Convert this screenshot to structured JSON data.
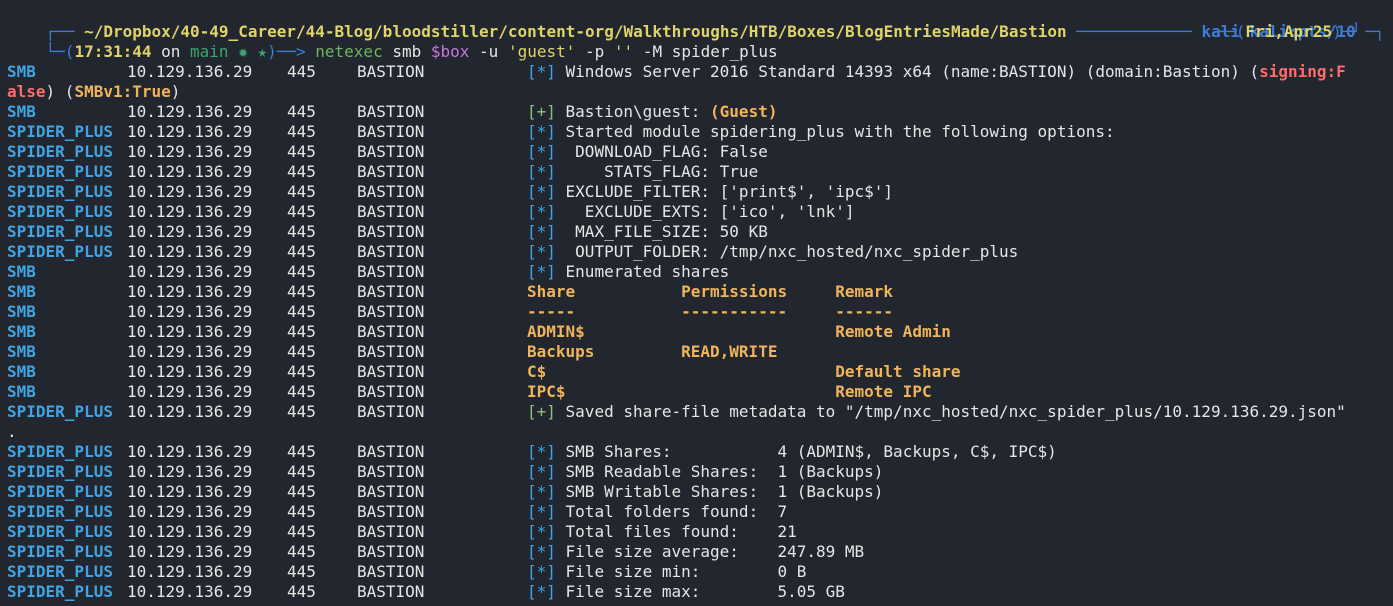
{
  "prompt": {
    "line1": {
      "corner": "┌── ",
      "path": "~/Dropbox/40-49_Career/44-Blog/bloodstiller/content-org/Walkthroughs/HTB/Boxes/BlogEntriesMade/Bastion",
      "sep": " ──────────── ",
      "user": "kali kali:pts/10",
      "end": " ─┐"
    },
    "line2": {
      "corner": "└─(",
      "time": "17:31:44",
      "on": " on ",
      "branch": "main ✹ ★",
      "arrow": ")──> ",
      "cmd": "netexec",
      "args1": " smb ",
      "var": "$box",
      "args2": " -u ",
      "user_str": "'guest'",
      "args3": " -p ",
      "pass_str": "''",
      "args4": " -M spider_plus",
      "date_prefix": "──(",
      "date": "Fri,Apr25",
      "date_suffix": ")─┘"
    }
  },
  "rows": [
    {
      "proto": "SMB",
      "ip": "10.129.136.29",
      "port": "445",
      "host": "BASTION",
      "badge": "[*]",
      "msg": " Windows Server 2016 Standard 14393 x64 (name:BASTION) (domain:Bastion) (",
      "hl": "signing:F",
      "type": "signing"
    },
    {
      "cont": "alse",
      "cont2": ") (",
      "hl": "SMBv1:True",
      "cont3": ")",
      "type": "wrap"
    },
    {
      "proto": "SMB",
      "ip": "10.129.136.29",
      "port": "445",
      "host": "BASTION",
      "badge": "[+]",
      "msg": " Bastion\\guest: ",
      "hl": "(Guest)",
      "type": "guest"
    },
    {
      "proto": "SPIDER_PLUS",
      "ip": "10.129.136.29",
      "port": "445",
      "host": "BASTION",
      "badge": "[*]",
      "msg": " Started module spidering_plus with the following options:"
    },
    {
      "proto": "SPIDER_PLUS",
      "ip": "10.129.136.29",
      "port": "445",
      "host": "BASTION",
      "badge": "[*]",
      "msg": "  DOWNLOAD_FLAG: False"
    },
    {
      "proto": "SPIDER_PLUS",
      "ip": "10.129.136.29",
      "port": "445",
      "host": "BASTION",
      "badge": "[*]",
      "msg": "     STATS_FLAG: True"
    },
    {
      "proto": "SPIDER_PLUS",
      "ip": "10.129.136.29",
      "port": "445",
      "host": "BASTION",
      "badge": "[*]",
      "msg": " EXCLUDE_FILTER: ['print$', 'ipc$']"
    },
    {
      "proto": "SPIDER_PLUS",
      "ip": "10.129.136.29",
      "port": "445",
      "host": "BASTION",
      "badge": "[*]",
      "msg": "   EXCLUDE_EXTS: ['ico', 'lnk']"
    },
    {
      "proto": "SPIDER_PLUS",
      "ip": "10.129.136.29",
      "port": "445",
      "host": "BASTION",
      "badge": "[*]",
      "msg": "  MAX_FILE_SIZE: 50 KB"
    },
    {
      "proto": "SPIDER_PLUS",
      "ip": "10.129.136.29",
      "port": "445",
      "host": "BASTION",
      "badge": "[*]",
      "msg": "  OUTPUT_FOLDER: /tmp/nxc_hosted/nxc_spider_plus"
    },
    {
      "proto": "SMB",
      "ip": "10.129.136.29",
      "port": "445",
      "host": "BASTION",
      "badge": "[*]",
      "msg": " Enumerated shares"
    },
    {
      "proto": "SMB",
      "ip": "10.129.136.29",
      "port": "445",
      "host": "BASTION",
      "share": "Share           Permissions     Remark",
      "type": "share"
    },
    {
      "proto": "SMB",
      "ip": "10.129.136.29",
      "port": "445",
      "host": "BASTION",
      "share": "-----           -----------     ------",
      "type": "share"
    },
    {
      "proto": "SMB",
      "ip": "10.129.136.29",
      "port": "445",
      "host": "BASTION",
      "share": "ADMIN$                          Remote Admin",
      "type": "share"
    },
    {
      "proto": "SMB",
      "ip": "10.129.136.29",
      "port": "445",
      "host": "BASTION",
      "share": "Backups         READ,WRITE",
      "type": "share"
    },
    {
      "proto": "SMB",
      "ip": "10.129.136.29",
      "port": "445",
      "host": "BASTION",
      "share": "C$                              Default share",
      "type": "share"
    },
    {
      "proto": "SMB",
      "ip": "10.129.136.29",
      "port": "445",
      "host": "BASTION",
      "share": "IPC$                            Remote IPC",
      "type": "share"
    },
    {
      "proto": "SPIDER_PLUS",
      "ip": "10.129.136.29",
      "port": "445",
      "host": "BASTION",
      "badge": "[+]",
      "msg": " Saved share-file metadata to \"/tmp/nxc_hosted/nxc_spider_plus/10.129.136.29.json\""
    },
    {
      "cont": ".",
      "type": "dot"
    },
    {
      "proto": "SPIDER_PLUS",
      "ip": "10.129.136.29",
      "port": "445",
      "host": "BASTION",
      "badge": "[*]",
      "msg": " SMB Shares:           4 (ADMIN$, Backups, C$, IPC$)"
    },
    {
      "proto": "SPIDER_PLUS",
      "ip": "10.129.136.29",
      "port": "445",
      "host": "BASTION",
      "badge": "[*]",
      "msg": " SMB Readable Shares:  1 (Backups)"
    },
    {
      "proto": "SPIDER_PLUS",
      "ip": "10.129.136.29",
      "port": "445",
      "host": "BASTION",
      "badge": "[*]",
      "msg": " SMB Writable Shares:  1 (Backups)"
    },
    {
      "proto": "SPIDER_PLUS",
      "ip": "10.129.136.29",
      "port": "445",
      "host": "BASTION",
      "badge": "[*]",
      "msg": " Total folders found:  7"
    },
    {
      "proto": "SPIDER_PLUS",
      "ip": "10.129.136.29",
      "port": "445",
      "host": "BASTION",
      "badge": "[*]",
      "msg": " Total files found:    21"
    },
    {
      "proto": "SPIDER_PLUS",
      "ip": "10.129.136.29",
      "port": "445",
      "host": "BASTION",
      "badge": "[*]",
      "msg": " File size average:    247.89 MB"
    },
    {
      "proto": "SPIDER_PLUS",
      "ip": "10.129.136.29",
      "port": "445",
      "host": "BASTION",
      "badge": "[*]",
      "msg": " File size min:        0 B"
    },
    {
      "proto": "SPIDER_PLUS",
      "ip": "10.129.136.29",
      "port": "445",
      "host": "BASTION",
      "badge": "[*]",
      "msg": " File size max:        5.05 GB"
    }
  ],
  "colors": {
    "background": "#22262e",
    "proto": "#3fa5e6",
    "highlight": "#f0b45a",
    "signing": "#ff6b6b",
    "success": "#8ec07c"
  }
}
